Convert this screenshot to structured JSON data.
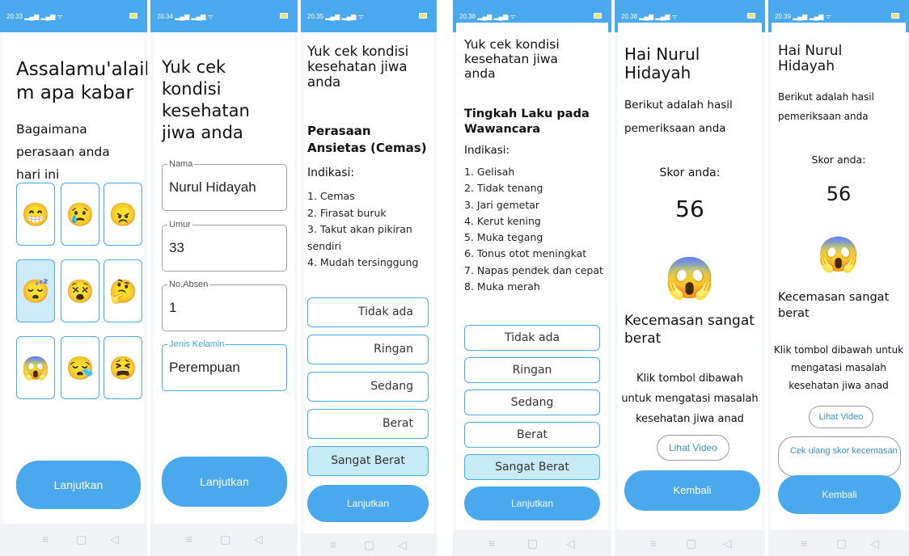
{
  "screens": [
    {
      "status_time": "20.33",
      "greeting": "Assalamu'alaiku m apa kabar",
      "question": "Bagaimana perasaan anda hari ini",
      "emojis": [
        "😁",
        "😢",
        "😠",
        "😴",
        "😵",
        "🤔",
        "😱",
        "😪",
        "😫"
      ],
      "button": "Lanjutkan"
    },
    {
      "status_time": "20.34",
      "title": "Yuk cek kondisi kesehatan jiwa anda",
      "fields": [
        {
          "label": "Nama",
          "value": "Nurul Hidayah"
        },
        {
          "label": "Umur",
          "value": "33"
        },
        {
          "label": "No.Absen",
          "value": "1"
        },
        {
          "label": "Jenis Kelamin",
          "value": "Perempuan"
        }
      ],
      "button": "Lanjutkan"
    },
    {
      "status_time": "20.35",
      "title": "Yuk cek kondisi kesehatan jiwa anda",
      "section": "Perasaan Ansietas (Cemas)",
      "indikasi_label": "Indikasi:",
      "indikasi": [
        "1. Cemas",
        "2. Firasat buruk",
        "3. Takut akan pikiran sendiri",
        "4. Mudah tersinggung"
      ],
      "options": [
        "Tidak ada",
        "Ringan",
        "Sedang",
        "Berat",
        "Sangat Berat"
      ],
      "selected_option": "Sangat Berat",
      "button": "Lanjutkan"
    },
    {
      "status_time": "20.38",
      "title": "Yuk cek kondisi kesehatan jiwa anda",
      "section": "Tingkah Laku pada Wawancara",
      "indikasi_label": "Indikasi:",
      "indikasi": [
        "1. Gelisah",
        "2. Tidak tenang",
        "3. Jari gemetar",
        "4. Kerut kening",
        "5. Muka tegang",
        "6. Tonus otot meningkat",
        "7. Napas pendek dan cepat",
        "8. Muka merah"
      ],
      "options": [
        "Tidak ada",
        "Ringan",
        "Sedang",
        "Berat",
        "Sangat Berat"
      ],
      "selected_option": "Sangat Berat",
      "button": "Lanjutkan"
    },
    {
      "status_time": "20.38",
      "greeting": "Hai Nurul Hidayah",
      "subtitle": "Berikut adalah hasil pemeriksaan anda",
      "score_label": "Skor anda:",
      "score": "56",
      "result_emoji": "😱",
      "result": "Kecemasan sangat berat",
      "hint": "Klik tombol dibawah untuk mengatasi masalah kesehatan jiwa anad",
      "video_button": "Lihat Video",
      "back_button": "Kembali"
    },
    {
      "status_time": "20.39",
      "greeting": "Hai Nurul Hidayah",
      "subtitle": "Berikut adalah hasil pemeriksaan anda",
      "score_label": "Skor anda:",
      "score": "56",
      "result_emoji": "😱",
      "result": "Kecemasan sangat berat",
      "hint": "Klik tombol dibawah untuk mengatasi masalah kesehatan jiwa anad",
      "video_button": "Lihat Video",
      "recheck_button": "Cek ulang skor kecemasan",
      "back_button": "Kembali"
    }
  ],
  "nav_icons": [
    "menu-icon",
    "home-icon",
    "back-icon"
  ],
  "colors": {
    "accent": "#4aa8ec",
    "selected": "#c6ebf5",
    "status_bar": "#4aa8ec"
  }
}
